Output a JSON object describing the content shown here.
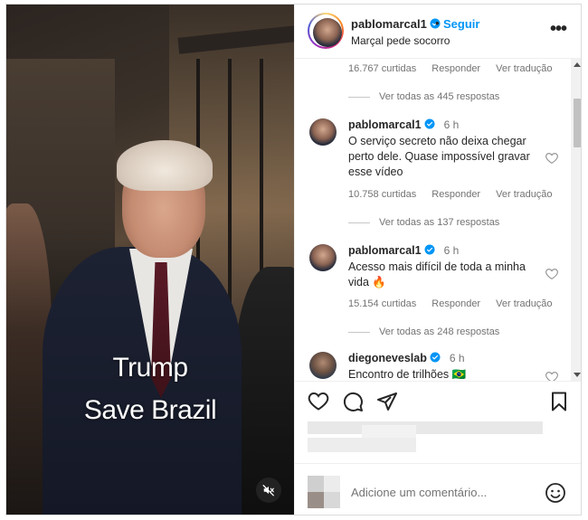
{
  "video": {
    "overlay_line1": "Trump",
    "overlay_line2": "Save Brazil",
    "muted": true
  },
  "header": {
    "username": "pablomarcal1",
    "separator": "•",
    "follow_label": "Seguir",
    "subtitle": "Marçal pede socorro",
    "more": "•••"
  },
  "top_meta": {
    "likes": "16.767 curtidas",
    "reply": "Responder",
    "translate": "Ver tradução",
    "replies": "Ver todas as 445 respostas"
  },
  "comments": [
    {
      "username": "pablomarcal1",
      "time": "6 h",
      "text": "O serviço secreto não deixa chegar perto dele. Quase impossível gravar esse vídeo",
      "likes": "10.758 curtidas",
      "reply": "Responder",
      "translate": "Ver tradução",
      "replies": "Ver todas as 137 respostas"
    },
    {
      "username": "pablomarcal1",
      "time": "6 h",
      "text": "Acesso mais difícil de toda a minha vida 🔥",
      "likes": "15.154 curtidas",
      "reply": "Responder",
      "translate": "Ver tradução",
      "replies": "Ver todas as 248 respostas"
    },
    {
      "username": "diegoneveslab",
      "time": "6 h",
      "text": "Encontro de trilhões 🇧🇷"
    }
  ],
  "actions": {
    "icons": [
      "heart-icon",
      "comment-icon",
      "share-icon",
      "bookmark-icon"
    ]
  },
  "add_comment": {
    "placeholder": "Adicione um comentário..."
  },
  "colors": {
    "accent": "#0095f6",
    "text": "#262626",
    "muted": "#737373",
    "border": "#dbdbdb"
  }
}
